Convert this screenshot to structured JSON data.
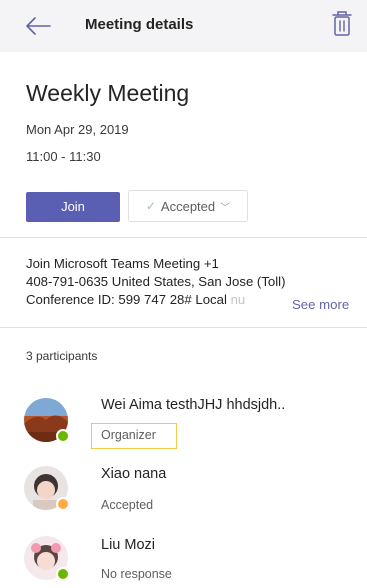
{
  "header": {
    "back_icon": "arrow-left-icon",
    "title": "Meeting details",
    "delete_icon": "trash-icon"
  },
  "meeting": {
    "title": "Weekly Meeting",
    "date": "Mon Apr 29, 2019",
    "time": "11:00 - 11:30"
  },
  "actions": {
    "join_label": "Join",
    "rsvp_label": "Accepted",
    "rsvp_check_icon": "checkmark-icon",
    "rsvp_dropdown_icon": "chevron-down-icon"
  },
  "join_info": {
    "line1": "Join Microsoft Teams Meeting +1",
    "line2": "408-791-0635 United States, San Jose (Toll)",
    "line3": "Conference ID: 599 747 28# Local ",
    "line3_faded": "nu",
    "see_more": "See more"
  },
  "participants": {
    "count_label": "3 participants",
    "items": [
      {
        "name": "Wei Aima testhJHJ hhdsjdh..",
        "role": "Organizer",
        "presence": "available",
        "presence_color": "#6bb700"
      },
      {
        "name": "Xiao nana",
        "role": "Accepted",
        "presence": "away",
        "presence_color": "#ffaa44"
      },
      {
        "name": "Liu Mozi",
        "role": "No response",
        "presence": "available",
        "presence_color": "#6bb700"
      }
    ]
  },
  "colors": {
    "accent": "#5b5fb3",
    "link": "#6264a7",
    "header_bg": "#f4f4f6",
    "highlight": "#f2c94c"
  }
}
